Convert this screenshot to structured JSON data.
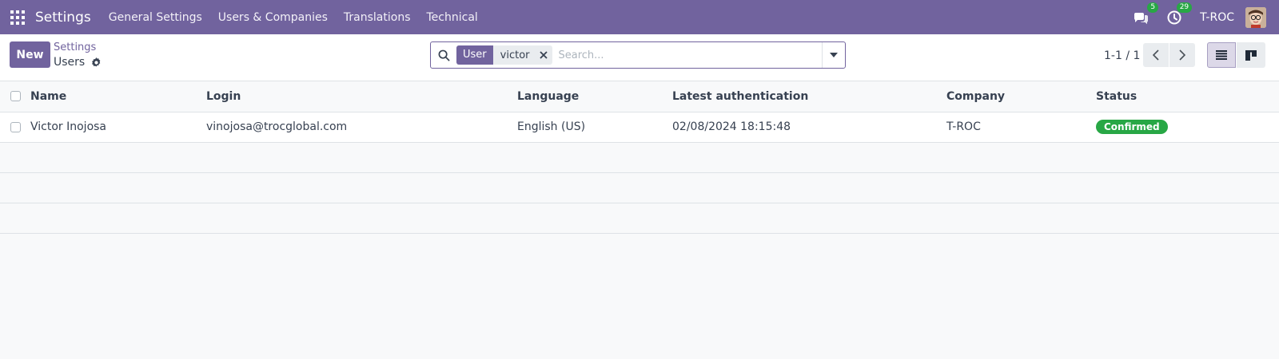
{
  "navbar": {
    "app_name": "Settings",
    "menu": [
      "General Settings",
      "Users & Companies",
      "Translations",
      "Technical"
    ],
    "messages_count": "5",
    "activities_count": "29",
    "company": "T-ROC",
    "color": "#71639e"
  },
  "control": {
    "new_label": "New",
    "breadcrumb": "Settings",
    "title": "Users",
    "search": {
      "facet_label": "User",
      "facet_value": "victor",
      "placeholder": "Search..."
    },
    "pager": "1-1 / 1"
  },
  "table": {
    "columns": [
      "Name",
      "Login",
      "Language",
      "Latest authentication",
      "Company",
      "Status"
    ],
    "rows": [
      {
        "name": "Victor Inojosa",
        "login": "vinojosa@trocglobal.com",
        "language": "English (US)",
        "latest_auth": "02/08/2024 18:15:48",
        "company": "T-ROC",
        "status": "Confirmed"
      }
    ]
  },
  "icons": [
    "apps-grid-icon",
    "chat-icon",
    "clock-icon",
    "gear-icon",
    "search-icon",
    "close-icon",
    "caret-down-icon",
    "chevron-left-icon",
    "chevron-right-icon",
    "list-view-icon",
    "kanban-view-icon"
  ]
}
